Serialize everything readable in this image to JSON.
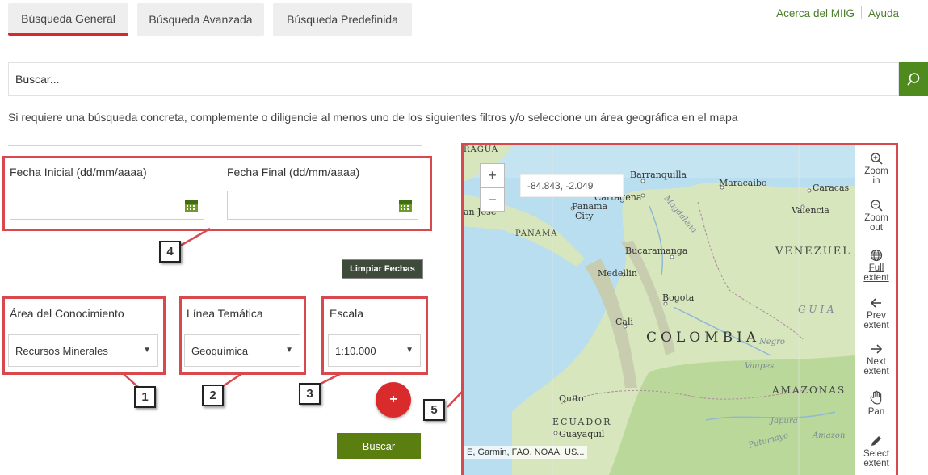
{
  "tabs": [
    "Búsqueda General",
    "Búsqueda Avanzada",
    "Búsqueda Predefinida"
  ],
  "top_links": {
    "about": "Acerca del MIIG",
    "help": "Ayuda"
  },
  "search": {
    "placeholder": "Buscar..."
  },
  "hint": "Si requiere una búsqueda concreta, complemente o diligencie al menos uno de los siguientes filtros y/o seleccione un área geográfica en el mapa",
  "dates": {
    "start_label": "Fecha Inicial (dd/mm/aaaa)",
    "end_label": "Fecha Final (dd/mm/aaaa)",
    "clear_button": "Limpiar Fechas"
  },
  "filters": {
    "area": {
      "label": "Área del Conocimiento",
      "value": "Recursos Minerales"
    },
    "linea": {
      "label": "Línea Temática",
      "value": "Geoquímica"
    },
    "escala": {
      "label": "Escala",
      "value": "1:10.000"
    }
  },
  "plus_button": "+",
  "submit_button": "Buscar",
  "callouts": [
    "1",
    "2",
    "3",
    "4",
    "5"
  ],
  "map": {
    "coords": "-84.843, -2.049",
    "zoom_in": "+",
    "zoom_out": "−",
    "attribution": "E, Garmin, FAO, NOAA, US...",
    "labels": {
      "ragua": "RAGUA",
      "barranquilla": "Barranquilla",
      "maracaibo": "Maracaibo",
      "caracas": "Caracas",
      "cartagena": "Cartagena",
      "panama": "Panama",
      "city": "City",
      "valencia": "Valencia",
      "panama_country": "PANAMA",
      "bucaramanga": "Bucaramanga",
      "venezuela": "VENEZUEL",
      "medellin": "Medellin",
      "bogota": "Bogota",
      "cali": "Cali",
      "colombia": "COLOMBIA",
      "guiana": "G U I A",
      "amazonas": "AMAZONAS",
      "quito": "Quito",
      "ecuador": "ECUADOR",
      "guayaquil": "Guayaquil",
      "japura": "Japura",
      "putumayo": "Putumayo",
      "amazon": "Amazon",
      "negro": "Negro",
      "magdalena": "Magdalena",
      "vaupes": "Vaupes",
      "san_jose": "an Jose"
    }
  },
  "map_tools": {
    "zoom_in": [
      "Zoom",
      "in"
    ],
    "zoom_out": [
      "Zoom",
      "out"
    ],
    "full_extent": [
      "Full",
      "extent"
    ],
    "prev_extent": [
      "Prev",
      "extent"
    ],
    "next_extent": [
      "Next",
      "extent"
    ],
    "pan": [
      "Pan"
    ],
    "select_extent": [
      "Select",
      "extent"
    ]
  },
  "colors": {
    "accent_green": "#4e8a1d",
    "highlight_red": "#d9484d",
    "tab_underline": "#d9282b"
  }
}
